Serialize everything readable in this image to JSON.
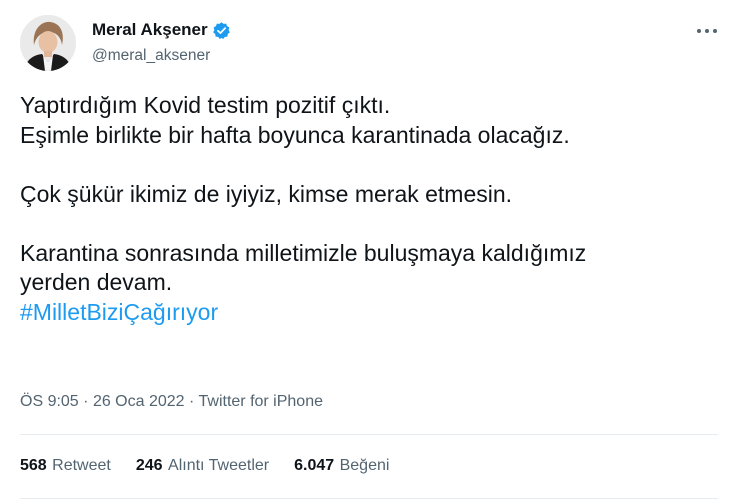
{
  "author": {
    "name": "Meral Akşener",
    "handle": "@meral_aksener",
    "verified_color": "#1d9bf0"
  },
  "more_icon": "ellipsis-icon",
  "tweet": {
    "lines": [
      "Yaptırdığım Kovid testim pozitif çıktı.",
      "Eşimle birlikte bir hafta boyunca karantinada olacağız.",
      "Çok şükür ikimiz de iyiyiz, kimse merak etmesin.",
      "Karantina sonrasında milletimizle buluşmaya kaldığımız",
      "yerden devam."
    ],
    "hashtag": "#MilletBiziÇağırıyor",
    "hashtag_color": "#1d9bf0"
  },
  "meta": {
    "time": "ÖS 9:05",
    "separator": "·",
    "date": "26 Oca 2022",
    "source": "Twitter for iPhone"
  },
  "stats": {
    "retweets": {
      "count": "568",
      "label": "Retweet"
    },
    "quotes": {
      "count": "246",
      "label": "Alıntı Tweetler"
    },
    "likes": {
      "count": "6.047",
      "label": "Beğeni"
    }
  }
}
